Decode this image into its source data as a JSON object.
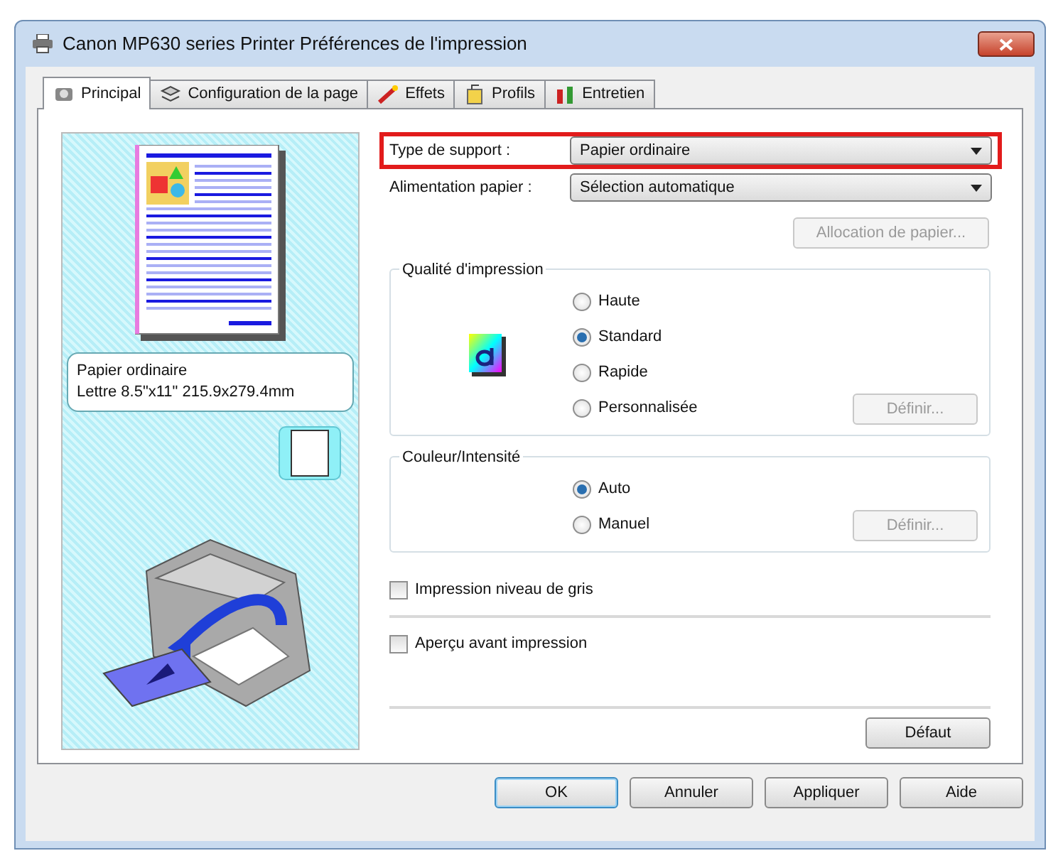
{
  "window": {
    "title": "Canon MP630 series Printer Préférences de l'impression"
  },
  "tabs": [
    {
      "label": "Principal",
      "selected": true
    },
    {
      "label": "Configuration de la page",
      "selected": false
    },
    {
      "label": "Effets",
      "selected": false
    },
    {
      "label": "Profils",
      "selected": false
    },
    {
      "label": "Entretien",
      "selected": false
    }
  ],
  "preview": {
    "media_lines": [
      "Papier ordinaire",
      "Lettre 8.5\"x11\" 215.9x279.4mm"
    ]
  },
  "fields": [
    {
      "label": "Type de support :",
      "value": "Papier ordinaire",
      "highlighted": true
    },
    {
      "label": "Alimentation papier :",
      "value": "Sélection automatique",
      "highlighted": false
    }
  ],
  "allocation_button": {
    "label": "Allocation de papier...",
    "disabled": true
  },
  "groups": [
    {
      "title": "Qualité d'impression",
      "options": [
        {
          "label": "Haute",
          "selected": false
        },
        {
          "label": "Standard",
          "selected": true
        },
        {
          "label": "Rapide",
          "selected": false
        },
        {
          "label": "Personnalisée",
          "selected": false
        }
      ],
      "button": {
        "label": "Définir...",
        "disabled": true
      }
    },
    {
      "title": "Couleur/Intensité",
      "options": [
        {
          "label": "Auto",
          "selected": true
        },
        {
          "label": "Manuel",
          "selected": false
        }
      ],
      "button": {
        "label": "Définir...",
        "disabled": true
      }
    }
  ],
  "checkboxes": [
    {
      "label": "Impression niveau de gris",
      "checked": false
    },
    {
      "label": "Aperçu avant impression",
      "checked": false
    }
  ],
  "default_button": {
    "label": "Défaut"
  },
  "footer_buttons": [
    {
      "label": "OK",
      "default": true
    },
    {
      "label": "Annuler",
      "default": false
    },
    {
      "label": "Appliquer",
      "default": false
    },
    {
      "label": "Aide",
      "default": false
    }
  ]
}
